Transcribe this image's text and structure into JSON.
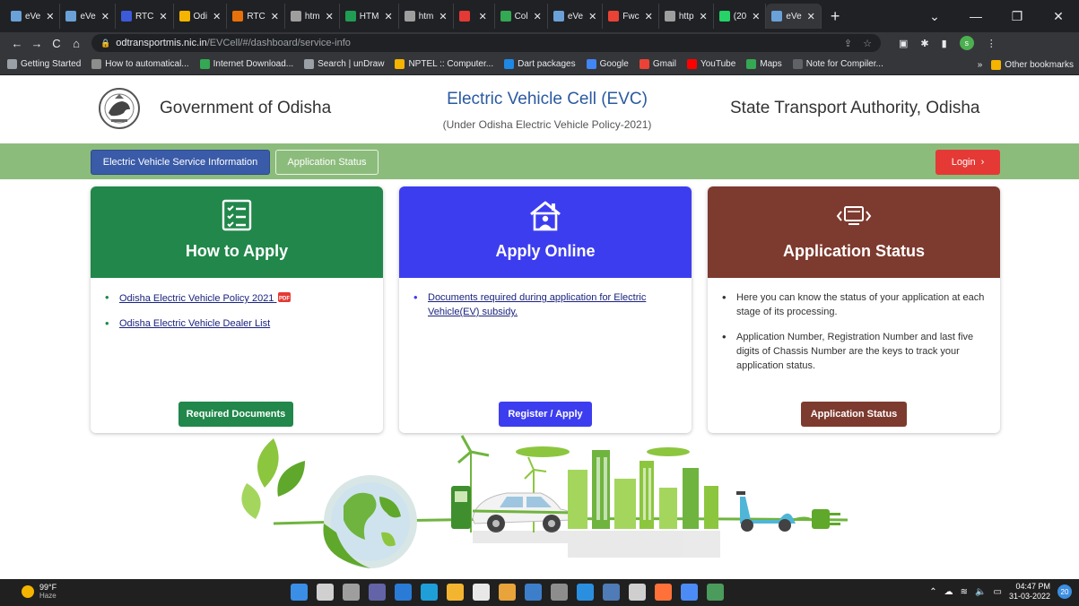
{
  "browser": {
    "tabs": [
      {
        "label": "eVe",
        "color": "#6aa1d8",
        "active": false
      },
      {
        "label": "eVe",
        "color": "#6aa1d8",
        "active": false
      },
      {
        "label": "RTC",
        "color": "#3b5bdb",
        "active": false
      },
      {
        "label": "Odi",
        "color": "#f4b400",
        "active": false
      },
      {
        "label": "RTC",
        "color": "#e8710a",
        "active": false
      },
      {
        "label": "htm",
        "color": "#9e9e9e",
        "active": false
      },
      {
        "label": "HTM",
        "color": "#1f9d55",
        "active": false
      },
      {
        "label": "htm",
        "color": "#9e9e9e",
        "active": false
      },
      {
        "label": "",
        "color": "#e53935",
        "active": false
      },
      {
        "label": "Col",
        "color": "#34a853",
        "active": false
      },
      {
        "label": "eVe",
        "color": "#6aa1d8",
        "active": false
      },
      {
        "label": "Fwc",
        "color": "#ea4335",
        "active": false
      },
      {
        "label": "http",
        "color": "#9e9e9e",
        "active": false
      },
      {
        "label": "(20",
        "color": "#25d366",
        "active": false
      },
      {
        "label": "eVe",
        "color": "#6aa1d8",
        "active": true
      }
    ],
    "new_tab": "+",
    "window_controls": {
      "dropdown": "⌄",
      "minimize": "—",
      "maximize": "❐",
      "close": "✕"
    },
    "nav": {
      "back": "←",
      "forward": "→",
      "reload": "C",
      "home": "⌂"
    },
    "url": {
      "host": "odtransportmis.nic.in",
      "path": "/EVCell/#/dashboard/service-info"
    },
    "profile_initial": "s",
    "bookmarks": [
      {
        "label": "Getting Started",
        "color": "#9aa0a6"
      },
      {
        "label": "How to automatical...",
        "color": "#8d8d8d"
      },
      {
        "label": "Internet Download...",
        "color": "#34a853"
      },
      {
        "label": "Search | unDraw",
        "color": "#9aa0a6"
      },
      {
        "label": "NPTEL :: Computer...",
        "color": "#f4b400"
      },
      {
        "label": "Dart packages",
        "color": "#1e88e5"
      },
      {
        "label": "Google",
        "color": "#4285f4"
      },
      {
        "label": "Gmail",
        "color": "#ea4335"
      },
      {
        "label": "YouTube",
        "color": "#ff0000"
      },
      {
        "label": "Maps",
        "color": "#34a853"
      },
      {
        "label": "Note for Compiler...",
        "color": "#5f6368"
      }
    ],
    "bookmarks_more": "»",
    "other_bookmarks": "Other bookmarks"
  },
  "header": {
    "gov_title": "Government of Odisha",
    "evc_title": "Electric Vehicle Cell (EVC)",
    "evc_subtitle": "(Under Odisha Electric Vehicle Policy-2021)",
    "sta_title": "State Transport Authority, Odisha"
  },
  "navbar": {
    "service_info": "Electric Vehicle Service Information",
    "application_status": "Application Status",
    "login": "Login",
    "login_arrow": "›"
  },
  "cards": {
    "how_to_apply": {
      "title": "How to Apply",
      "items": [
        "Odisha Electric Vehicle Policy 2021",
        "Odisha Electric Vehicle Dealer List"
      ],
      "pdf_badge": "PDF",
      "button": "Required Documents"
    },
    "apply_online": {
      "title": "Apply Online",
      "items": [
        "Documents required during application for Electric Vehicle(EV) subsidy."
      ],
      "button": "Register / Apply"
    },
    "application_status": {
      "title": "Application Status",
      "items": [
        "Here you can know the status of your application at each stage of its processing.",
        "Application Number, Registration Number and last five digits of Chassis Number are the keys to track your application status."
      ],
      "button": "Application Status"
    }
  },
  "taskbar": {
    "temperature": "99°F",
    "weather": "Haze",
    "time": "04:47 PM",
    "date": "31-03-2022",
    "notification_count": "20",
    "apps": [
      {
        "name": "windows-start",
        "color": "#3a8ee6"
      },
      {
        "name": "search",
        "color": "#d0d0d0"
      },
      {
        "name": "task-view",
        "color": "#9e9e9e"
      },
      {
        "name": "teams",
        "color": "#6264a7"
      },
      {
        "name": "mail",
        "color": "#2a7bd6"
      },
      {
        "name": "edge",
        "color": "#1e9fd8"
      },
      {
        "name": "file-explorer",
        "color": "#f3b530"
      },
      {
        "name": "store",
        "color": "#e8e8e8"
      },
      {
        "name": "chrome",
        "color": "#e8a33b"
      },
      {
        "name": "photos",
        "color": "#3d7ecb"
      },
      {
        "name": "settings",
        "color": "#8d8d8d"
      },
      {
        "name": "vscode",
        "color": "#2b8fe0"
      },
      {
        "name": "pgadmin",
        "color": "#4f7bb6"
      },
      {
        "name": "terminal",
        "color": "#cfcfcf"
      },
      {
        "name": "firefox",
        "color": "#ff7139"
      },
      {
        "name": "notepad",
        "color": "#4c8bf5"
      },
      {
        "name": "excel",
        "color": "#4b9b5c"
      }
    ]
  }
}
